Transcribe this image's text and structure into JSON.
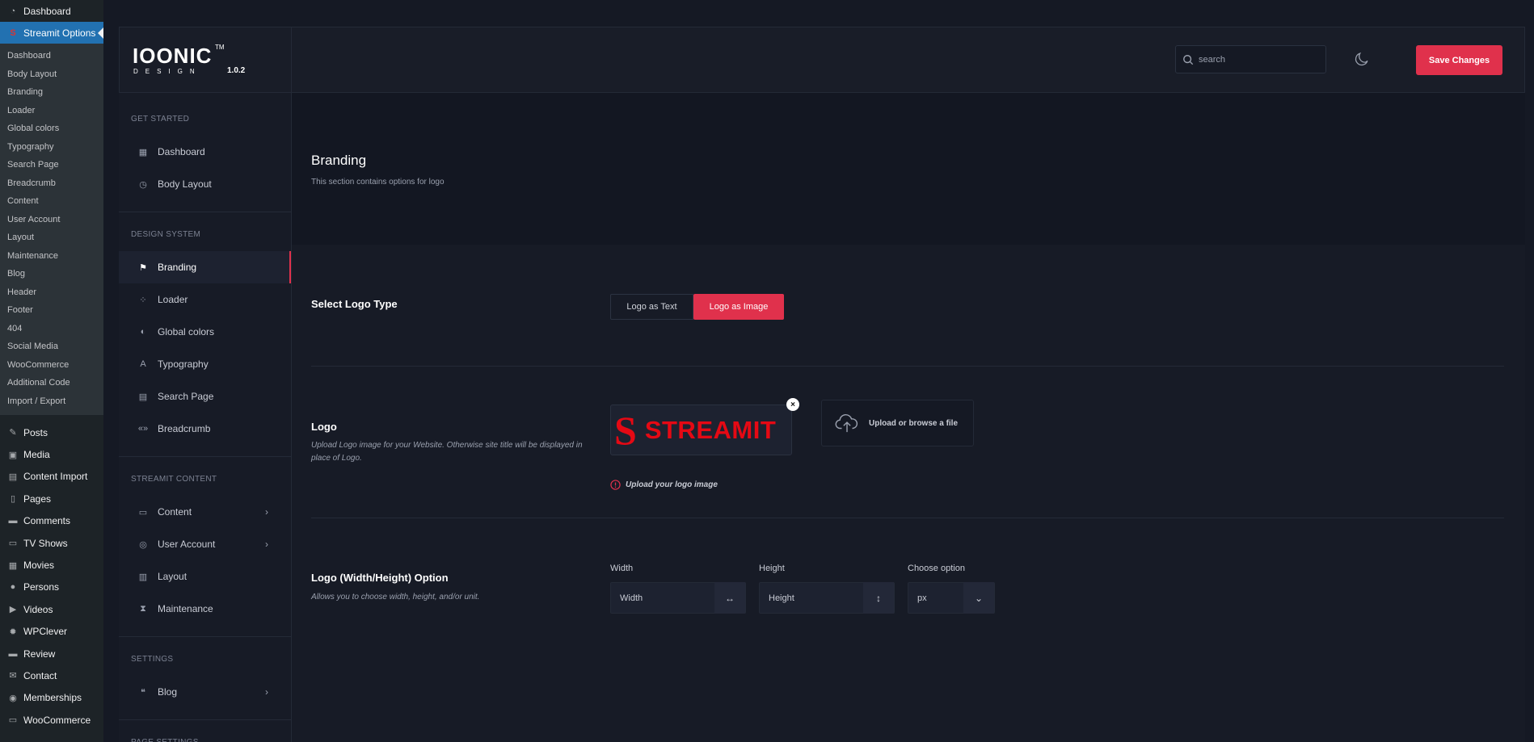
{
  "wp_menu": {
    "top": [
      {
        "label": "Dashboard",
        "icon": "dashboard-icon"
      },
      {
        "label": "Streamit Options",
        "icon": "streamit-icon"
      }
    ],
    "submenu": [
      "Dashboard",
      "Body Layout",
      "Branding",
      "Loader",
      "Global colors",
      "Typography",
      "Search Page",
      "Breadcrumb",
      "Content",
      "User Account",
      "Layout",
      "Maintenance",
      "Blog",
      "Header",
      "Footer",
      "404",
      "Social Media",
      "WooCommerce",
      "Additional Code",
      "Import / Export"
    ],
    "lower": [
      {
        "label": "Posts",
        "icon": "pin-icon"
      },
      {
        "label": "Media",
        "icon": "media-icon"
      },
      {
        "label": "Content Import",
        "icon": "import-icon"
      },
      {
        "label": "Pages",
        "icon": "pages-icon"
      },
      {
        "label": "Comments",
        "icon": "comments-icon"
      },
      {
        "label": "TV Shows",
        "icon": "tv-icon"
      },
      {
        "label": "Movies",
        "icon": "movies-icon"
      },
      {
        "label": "Persons",
        "icon": "person-icon"
      },
      {
        "label": "Videos",
        "icon": "video-icon"
      },
      {
        "label": "WPClever",
        "icon": "gear-icon"
      },
      {
        "label": "Review",
        "icon": "review-icon"
      },
      {
        "label": "Contact",
        "icon": "mail-icon"
      },
      {
        "label": "Memberships",
        "icon": "membership-icon"
      },
      {
        "label": "WooCommerce",
        "icon": "woocommerce-icon"
      }
    ]
  },
  "brand": {
    "word": "IOONIC",
    "tm": "TM",
    "sub": "DESIGN",
    "version": "1.0.2"
  },
  "header": {
    "search_placeholder": "search",
    "save_label": "Save Changes",
    "accent": "#e0314c"
  },
  "sidebar": {
    "sections": [
      {
        "title": "GET STARTED",
        "items": [
          {
            "label": "Dashboard",
            "icon": "grid-icon",
            "chevron": false
          },
          {
            "label": "Body Layout",
            "icon": "gauge-icon",
            "chevron": false
          }
        ]
      },
      {
        "title": "DESIGN SYSTEM",
        "items": [
          {
            "label": "Branding",
            "icon": "flag-icon",
            "chevron": false,
            "active": true
          },
          {
            "label": "Loader",
            "icon": "loader-icon",
            "chevron": false
          },
          {
            "label": "Global colors",
            "icon": "contrast-icon",
            "chevron": false
          },
          {
            "label": "Typography",
            "icon": "typography-icon",
            "chevron": false
          },
          {
            "label": "Search Page",
            "icon": "page-icon",
            "chevron": false
          },
          {
            "label": "Breadcrumb",
            "icon": "breadcrumb-icon",
            "chevron": false
          }
        ]
      },
      {
        "title": "STREAMIT CONTENT",
        "items": [
          {
            "label": "Content",
            "icon": "window-icon",
            "chevron": true
          },
          {
            "label": "User Account",
            "icon": "user-circle-icon",
            "chevron": true
          },
          {
            "label": "Layout",
            "icon": "layout-icon",
            "chevron": false
          },
          {
            "label": "Maintenance",
            "icon": "hourglass-icon",
            "chevron": false
          }
        ]
      },
      {
        "title": "SETTINGS",
        "items": [
          {
            "label": "Blog",
            "icon": "blog-icon",
            "chevron": true
          }
        ]
      },
      {
        "title": "PAGE SETTINGS",
        "items": []
      }
    ]
  },
  "page": {
    "title": "Branding",
    "description": "This section contains options for logo"
  },
  "logo_type": {
    "title": "Select Logo Type",
    "option_text": "Logo as Text",
    "option_image": "Logo as Image",
    "selected": "Logo as Image"
  },
  "logo": {
    "title": "Logo",
    "description": "Upload Logo image for your Website. Otherwise site title will be displayed in place of Logo.",
    "preview_mark": "S",
    "preview_word": "STREAMIT",
    "remove_glyph": "×",
    "upload_label": "Upload or browse a file",
    "warning": "Upload your logo image"
  },
  "logo_size": {
    "title": "Logo (Width/Height) Option",
    "description": "Allows you to choose width, height, and/or unit.",
    "width_label": "Width",
    "width_placeholder": "Width",
    "height_label": "Height",
    "height_placeholder": "Height",
    "unit_label": "Choose option",
    "unit_value": "px"
  }
}
